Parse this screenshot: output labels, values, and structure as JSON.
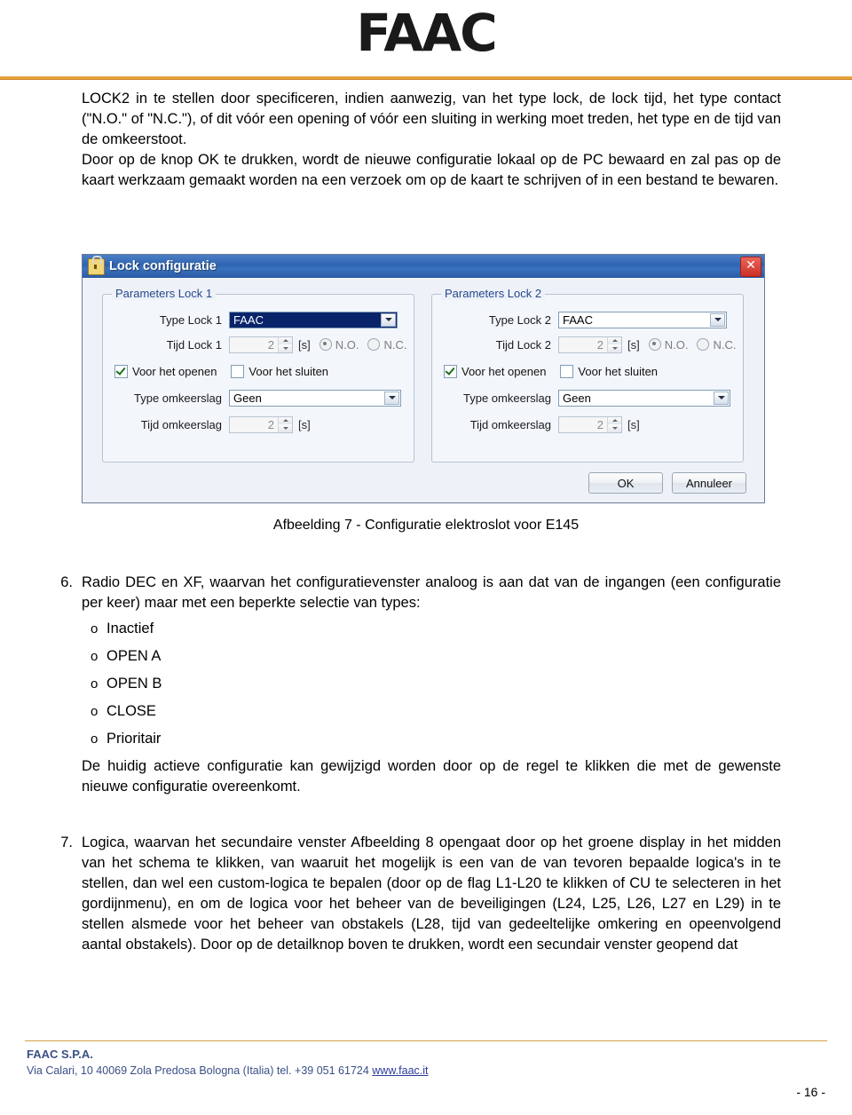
{
  "header": {
    "logo_text": "FAAC"
  },
  "intro": {
    "para1": "LOCK2 in te stellen door specificeren, indien aanwezig, van het type lock, de lock tijd, het type contact (\"N.O.\" of \"N.C.\"), of dit vóór een opening of vóór een sluiting in werking moet treden, het type en de tijd van de omkeerstoot.",
    "para2": "Door op de knop OK te drukken, wordt de nieuwe configuratie lokaal op de PC bewaard en zal pas op de kaart werkzaam gemaakt worden na een verzoek om op de kaart te schrijven of in een bestand te bewaren."
  },
  "dialog": {
    "title": "Lock configuratie",
    "close_label": "✕",
    "group1": {
      "title": "Parameters Lock 1",
      "type_label": "Type Lock 1",
      "type_value": "FAAC",
      "time_label": "Tijd Lock 1",
      "time_value": "2",
      "time_unit": "[s]",
      "radio_no": "N.O.",
      "radio_nc": "N.C.",
      "check_open": "Voor het openen",
      "check_close": "Voor het sluiten",
      "reverse_type_label": "Type omkeerslag",
      "reverse_type_value": "Geen",
      "reverse_time_label": "Tijd omkeerslag",
      "reverse_time_value": "2",
      "reverse_time_unit": "[s]"
    },
    "group2": {
      "title": "Parameters Lock 2",
      "type_label": "Type Lock 2",
      "type_value": "FAAC",
      "time_label": "Tijd Lock 2",
      "time_value": "2",
      "time_unit": "[s]",
      "radio_no": "N.O.",
      "radio_nc": "N.C.",
      "check_open": "Voor het openen",
      "check_close": "Voor het sluiten",
      "reverse_type_label": "Type omkeerslag",
      "reverse_type_value": "Geen",
      "reverse_time_label": "Tijd omkeerslag",
      "reverse_time_value": "2",
      "reverse_time_unit": "[s]"
    },
    "ok_label": "OK",
    "cancel_label": "Annuleer"
  },
  "caption": "Afbeelding 7 -  Configuratie elektroslot voor E145",
  "items": [
    {
      "number": "6.",
      "text": "Radio DEC en XF, waarvan het configuratievenster analoog is aan dat van de ingangen (een configuratie per keer) maar met een beperkte selectie van types:",
      "bullets": [
        "Inactief",
        "OPEN A",
        "OPEN B",
        "CLOSE",
        "Prioritair"
      ],
      "after": "De huidig actieve configuratie kan gewijzigd worden door op de regel te klikken die met de gewenste nieuwe configuratie overeenkomt."
    },
    {
      "number": "7.",
      "text": "Logica, waarvan het secundaire venster Afbeelding 8 opengaat door op het groene display in het midden van het schema te klikken, van waaruit het mogelijk is een van de van tevoren bepaalde logica's in te stellen, dan wel een custom-logica te bepalen (door op de flag L1-L20 te klikken of CU te selecteren in het gordijnmenu),  en om de logica voor het beheer van de beveiligingen (L24, L25, L26, L27 en L29) in te stellen alsmede voor het beheer van obstakels (L28, tijd van gedeeltelijke omkering en opeenvolgend aantal obstakels).  Door op de detailknop boven te drukken, wordt een secundair venster geopend dat"
    }
  ],
  "footer": {
    "company": "FAAC S.P.A.",
    "address": "Via Calari, 10 40069 Zola Predosa Bologna (Italia) tel. +39 051 61724 ",
    "link": "www.faac.it",
    "page_number": "- 16 -"
  }
}
